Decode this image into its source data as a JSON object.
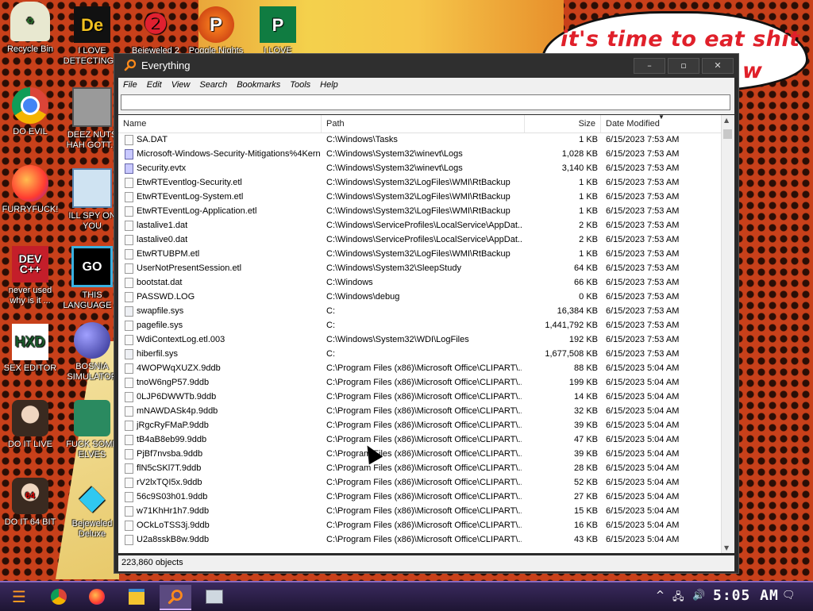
{
  "desktop": {
    "speech_line1": "it's time to eat shit",
    "speech_line2": "w",
    "icons": [
      {
        "label": "Recycle Bin"
      },
      {
        "label": "I LOVE DETECTING..."
      },
      {
        "label": "Bejeweled 2"
      },
      {
        "label": "Poggle Nights"
      },
      {
        "label": "I LOVE"
      },
      {
        "label": "DO EVIL"
      },
      {
        "label": "DEEZ NUTS HAH GOTT..."
      },
      {
        "label": "FURRYFUCK!"
      },
      {
        "label": "ILL SPY ON YOU"
      },
      {
        "label": "never used why is it ..."
      },
      {
        "label": "THIS LANGUAGE ..."
      },
      {
        "label": "SEX EDITOR"
      },
      {
        "label": "BOSNIA SIMULATOR"
      },
      {
        "label": "DO IT LIVE"
      },
      {
        "label": "FUCK SOME ELVES"
      },
      {
        "label": "DO IT 64 BIT"
      },
      {
        "label": "Bejeweled Deluxe"
      }
    ]
  },
  "window": {
    "title": "Everything",
    "minimize": "–",
    "maximize": "▫",
    "close": "✕",
    "menu": [
      "File",
      "Edit",
      "View",
      "Search",
      "Bookmarks",
      "Tools",
      "Help"
    ],
    "search_value": "",
    "columns": {
      "name": "Name",
      "path": "Path",
      "size": "Size",
      "date": "Date Modified"
    },
    "rows": [
      {
        "name": "SA.DAT",
        "path": "C:\\Windows\\Tasks",
        "size": "1 KB",
        "date": "6/15/2023 7:53 AM",
        "icon": "file"
      },
      {
        "name": "Microsoft-Windows-Security-Mitigations%4Kern...",
        "path": "C:\\Windows\\System32\\winevt\\Logs",
        "size": "1,028 KB",
        "date": "6/15/2023 7:53 AM",
        "icon": "evtx"
      },
      {
        "name": "Security.evtx",
        "path": "C:\\Windows\\System32\\winevt\\Logs",
        "size": "3,140 KB",
        "date": "6/15/2023 7:53 AM",
        "icon": "evtx"
      },
      {
        "name": "EtwRTEventlog-Security.etl",
        "path": "C:\\Windows\\System32\\LogFiles\\WMI\\RtBackup",
        "size": "1 KB",
        "date": "6/15/2023 7:53 AM",
        "icon": "file"
      },
      {
        "name": "EtwRTEventLog-System.etl",
        "path": "C:\\Windows\\System32\\LogFiles\\WMI\\RtBackup",
        "size": "1 KB",
        "date": "6/15/2023 7:53 AM",
        "icon": "file"
      },
      {
        "name": "EtwRTEventLog-Application.etl",
        "path": "C:\\Windows\\System32\\LogFiles\\WMI\\RtBackup",
        "size": "1 KB",
        "date": "6/15/2023 7:53 AM",
        "icon": "file"
      },
      {
        "name": "lastalive1.dat",
        "path": "C:\\Windows\\ServiceProfiles\\LocalService\\AppDat...",
        "size": "2 KB",
        "date": "6/15/2023 7:53 AM",
        "icon": "file"
      },
      {
        "name": "lastalive0.dat",
        "path": "C:\\Windows\\ServiceProfiles\\LocalService\\AppDat...",
        "size": "2 KB",
        "date": "6/15/2023 7:53 AM",
        "icon": "file"
      },
      {
        "name": "EtwRTUBPM.etl",
        "path": "C:\\Windows\\System32\\LogFiles\\WMI\\RtBackup",
        "size": "1 KB",
        "date": "6/15/2023 7:53 AM",
        "icon": "file"
      },
      {
        "name": "UserNotPresentSession.etl",
        "path": "C:\\Windows\\System32\\SleepStudy",
        "size": "64 KB",
        "date": "6/15/2023 7:53 AM",
        "icon": "file"
      },
      {
        "name": "bootstat.dat",
        "path": "C:\\Windows",
        "size": "66 KB",
        "date": "6/15/2023 7:53 AM",
        "icon": "file"
      },
      {
        "name": "PASSWD.LOG",
        "path": "C:\\Windows\\debug",
        "size": "0 KB",
        "date": "6/15/2023 7:53 AM",
        "icon": "file"
      },
      {
        "name": "swapfile.sys",
        "path": "C:",
        "size": "16,384 KB",
        "date": "6/15/2023 7:53 AM",
        "icon": "sys"
      },
      {
        "name": "pagefile.sys",
        "path": "C:",
        "size": "1,441,792 KB",
        "date": "6/15/2023 7:53 AM",
        "icon": "file"
      },
      {
        "name": "WdiContextLog.etl.003",
        "path": "C:\\Windows\\System32\\WDI\\LogFiles",
        "size": "192 KB",
        "date": "6/15/2023 7:53 AM",
        "icon": "file"
      },
      {
        "name": "hiberfil.sys",
        "path": "C:",
        "size": "1,677,508 KB",
        "date": "6/15/2023 7:53 AM",
        "icon": "sys"
      },
      {
        "name": "4WOPWqXUZX.9ddb",
        "path": "C:\\Program Files (x86)\\Microsoft Office\\CLIPART\\...",
        "size": "88 KB",
        "date": "6/15/2023 5:04 AM",
        "icon": "file"
      },
      {
        "name": "tnoW6ngP57.9ddb",
        "path": "C:\\Program Files (x86)\\Microsoft Office\\CLIPART\\...",
        "size": "199 KB",
        "date": "6/15/2023 5:04 AM",
        "icon": "file"
      },
      {
        "name": "0LJP6DWWTb.9ddb",
        "path": "C:\\Program Files (x86)\\Microsoft Office\\CLIPART\\...",
        "size": "14 KB",
        "date": "6/15/2023 5:04 AM",
        "icon": "file"
      },
      {
        "name": "mNAWDASk4p.9ddb",
        "path": "C:\\Program Files (x86)\\Microsoft Office\\CLIPART\\...",
        "size": "32 KB",
        "date": "6/15/2023 5:04 AM",
        "icon": "file"
      },
      {
        "name": "jRgcRyFMaP.9ddb",
        "path": "C:\\Program Files (x86)\\Microsoft Office\\CLIPART\\...",
        "size": "39 KB",
        "date": "6/15/2023 5:04 AM",
        "icon": "file"
      },
      {
        "name": "tB4aB8eb99.9ddb",
        "path": "C:\\Program Files (x86)\\Microsoft Office\\CLIPART\\...",
        "size": "47 KB",
        "date": "6/15/2023 5:04 AM",
        "icon": "file"
      },
      {
        "name": "PjBf7nvsba.9ddb",
        "path": "C:\\Program Files (x86)\\Microsoft Office\\CLIPART\\...",
        "size": "39 KB",
        "date": "6/15/2023 5:04 AM",
        "icon": "file"
      },
      {
        "name": "flN5cSKl7T.9ddb",
        "path": "C:\\Program Files (x86)\\Microsoft Office\\CLIPART\\...",
        "size": "28 KB",
        "date": "6/15/2023 5:04 AM",
        "icon": "file"
      },
      {
        "name": "rV2lxTQI5x.9ddb",
        "path": "C:\\Program Files (x86)\\Microsoft Office\\CLIPART\\...",
        "size": "52 KB",
        "date": "6/15/2023 5:04 AM",
        "icon": "file"
      },
      {
        "name": "56c9S03h01.9ddb",
        "path": "C:\\Program Files (x86)\\Microsoft Office\\CLIPART\\...",
        "size": "27 KB",
        "date": "6/15/2023 5:04 AM",
        "icon": "file"
      },
      {
        "name": "w71KhHr1h7.9ddb",
        "path": "C:\\Program Files (x86)\\Microsoft Office\\CLIPART\\...",
        "size": "15 KB",
        "date": "6/15/2023 5:04 AM",
        "icon": "file"
      },
      {
        "name": "OCkLoTSS3j.9ddb",
        "path": "C:\\Program Files (x86)\\Microsoft Office\\CLIPART\\...",
        "size": "16 KB",
        "date": "6/15/2023 5:04 AM",
        "icon": "file"
      },
      {
        "name": "U2a8sskB8w.9ddb",
        "path": "C:\\Program Files (x86)\\Microsoft Office\\CLIPART\\...",
        "size": "43 KB",
        "date": "6/15/2023 5:04 AM",
        "icon": "file"
      }
    ],
    "status": "223,860 objects"
  },
  "taskbar": {
    "clock": "5:05 AM",
    "apps": [
      "start-icon",
      "chrome-icon",
      "firefox-icon",
      "file-explorer-icon",
      "everything-search-icon",
      "task-manager-icon"
    ]
  }
}
